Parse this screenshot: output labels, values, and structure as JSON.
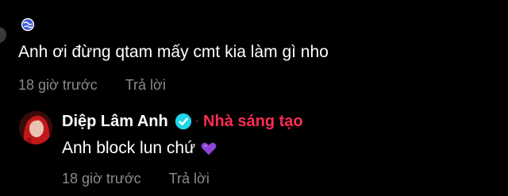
{
  "thread": {
    "comment": {
      "text": "Anh ơi đừng qtam mấy cmt kia làm gì nho",
      "time": "18 giờ trước",
      "reply_label": "Trả lời"
    },
    "reply": {
      "author": "Diệp Lâm Anh",
      "separator": "·",
      "creator_badge": "Nhà sáng tạo",
      "text": "Anh block lun chứ",
      "time": "18 giờ trước",
      "reply_label": "Trả lời"
    }
  },
  "colors": {
    "background": "#000000",
    "text": "#ffffff",
    "meta": "#8a8a8a",
    "creator": "#fe2c55",
    "verified": "#20d5ec",
    "heart": "#8e44d8"
  }
}
